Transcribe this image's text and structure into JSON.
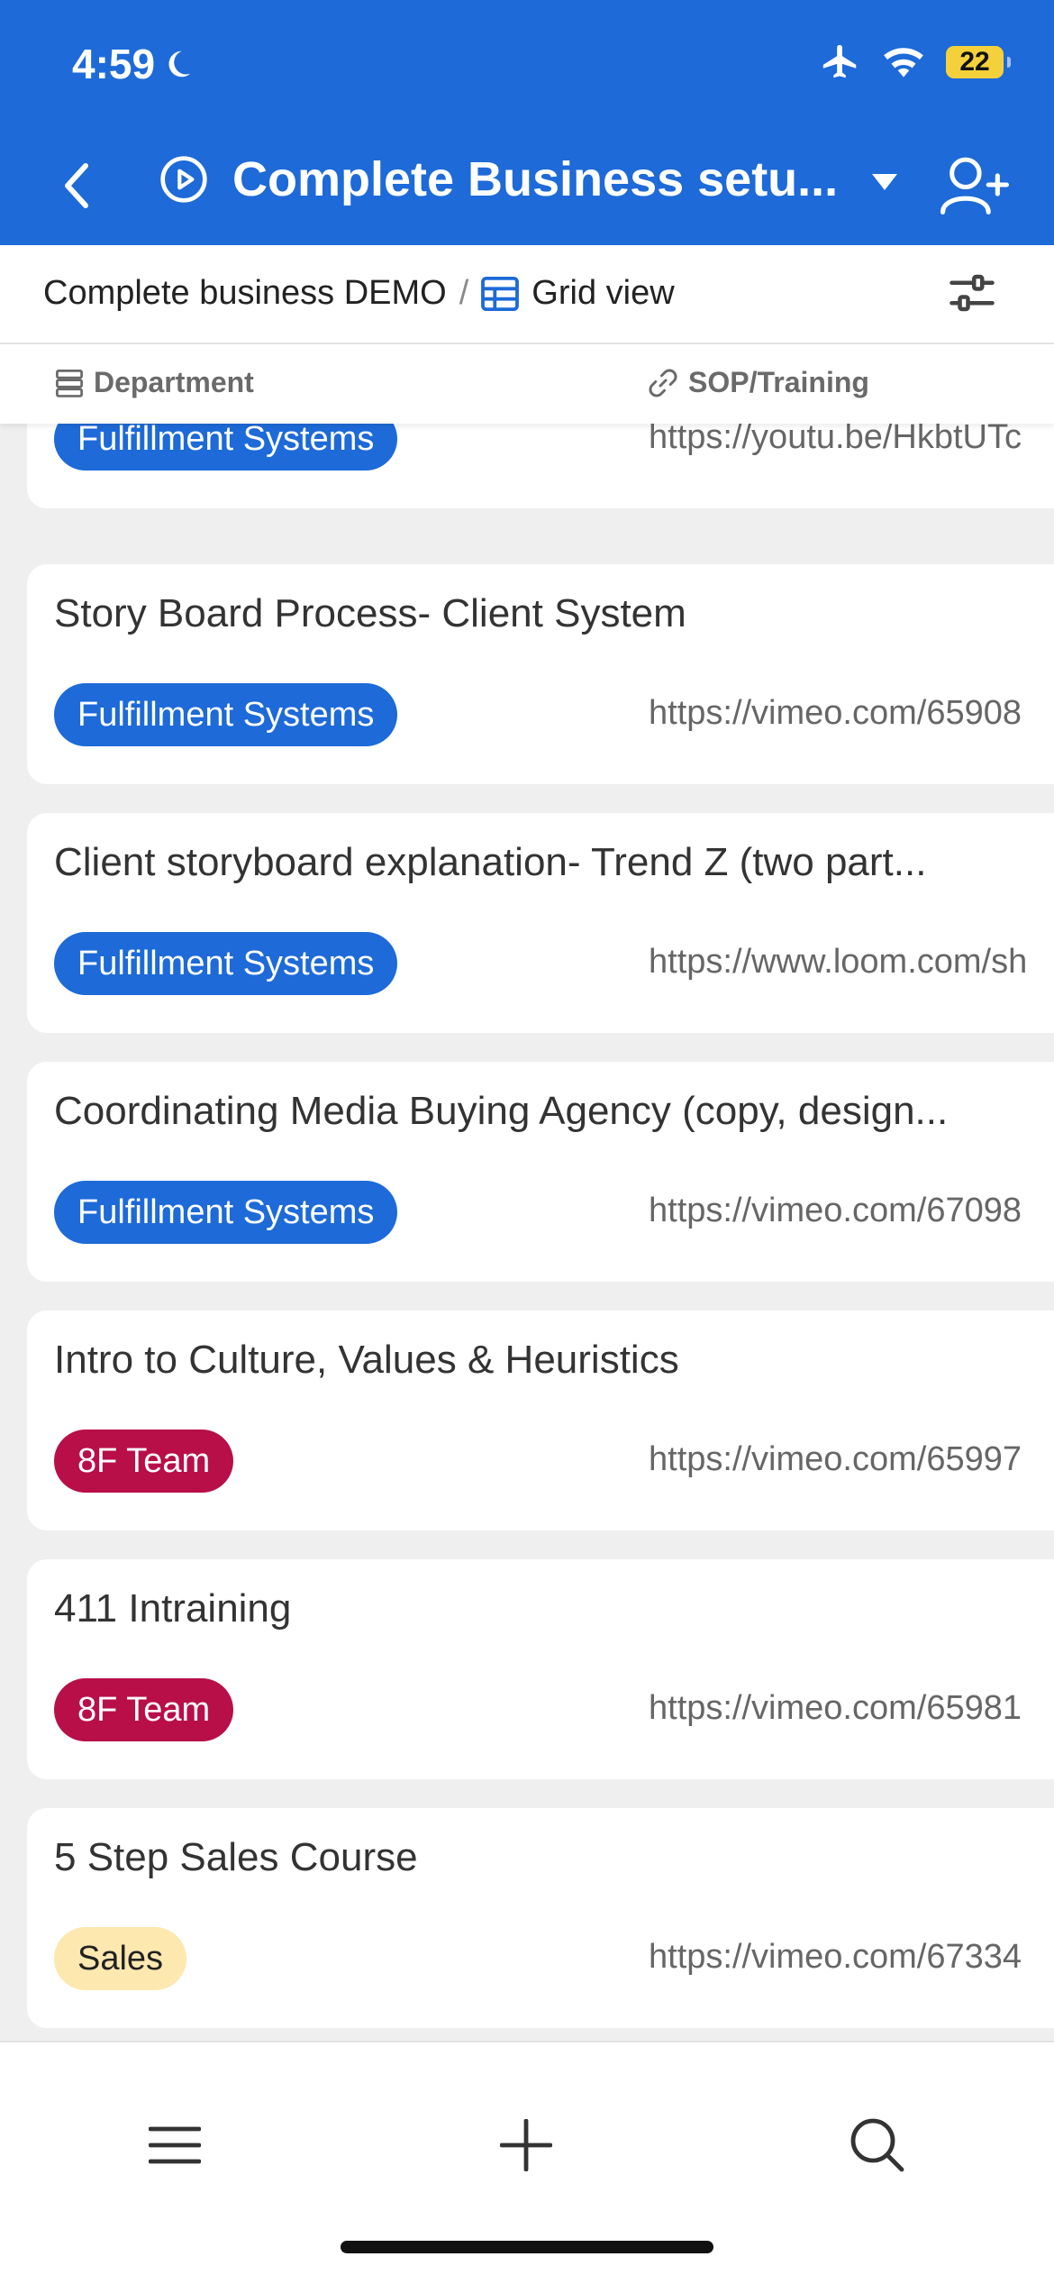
{
  "status": {
    "time": "4:59",
    "battery": "22"
  },
  "nav": {
    "title": "Complete Business setu..."
  },
  "breadcrumb": {
    "base": "Complete business DEMO",
    "separator": "/",
    "view": "Grid view"
  },
  "columns": {
    "department": "Department",
    "sop": "SOP/Training"
  },
  "colors": {
    "brand": "#1d6ad8",
    "tag_fulfillment": "#1d6ad8",
    "tag_team": "#b80f48",
    "tag_sales": "#fde8b0"
  },
  "records": [
    {
      "title": "",
      "tag": "Fulfillment Systems",
      "link": "https://youtu.be/HkbtUTc"
    },
    {
      "title": "Story Board Process- Client System",
      "tag": "Fulfillment Systems",
      "link": "https://vimeo.com/65908"
    },
    {
      "title": "Client storyboard explanation- Trend Z (two part...",
      "tag": "Fulfillment Systems",
      "link": "https://www.loom.com/sh"
    },
    {
      "title": "Coordinating Media Buying Agency (copy, design...",
      "tag": "Fulfillment Systems",
      "link": "https://vimeo.com/67098"
    },
    {
      "title": "Intro to Culture, Values & Heuristics",
      "tag": "8F Team",
      "link": "https://vimeo.com/65997"
    },
    {
      "title": "411 Intraining",
      "tag": "8F Team",
      "link": "https://vimeo.com/65981"
    },
    {
      "title": "5 Step Sales Course",
      "tag": "Sales",
      "link": "https://vimeo.com/67334"
    }
  ],
  "bottom_bar": {
    "icons": [
      "menu-icon",
      "plus-icon",
      "search-icon"
    ]
  }
}
